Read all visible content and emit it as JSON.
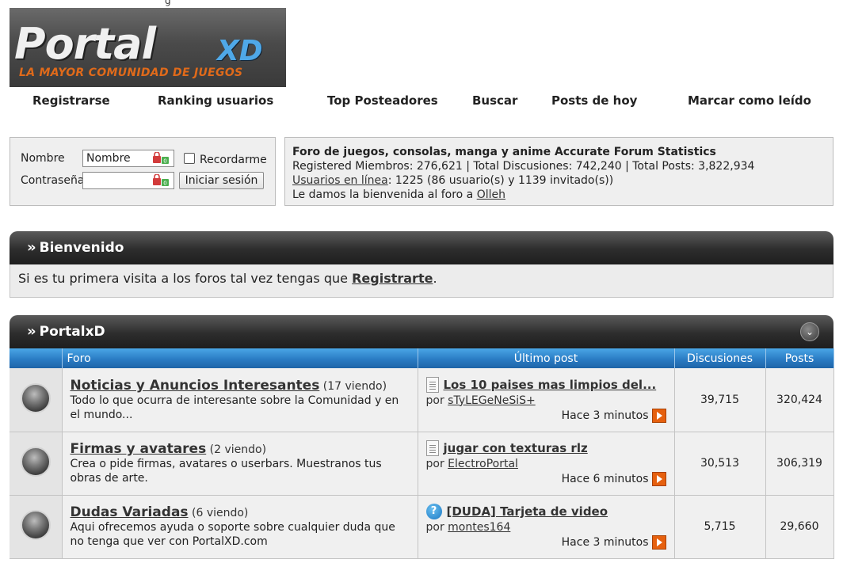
{
  "header": {
    "logo_main": "Portal",
    "logo_xd": "XD",
    "logo_tagline": "LA MAYOR COMUNIDAD DE JUEGOS",
    "clipped_top_text": "g"
  },
  "nav": {
    "items": [
      {
        "label": "Registrarse"
      },
      {
        "label": "Ranking usuarios"
      },
      {
        "label": "Top Posteadores"
      },
      {
        "label": "Buscar"
      },
      {
        "label": "Posts de hoy"
      },
      {
        "label": "Marcar como leído"
      }
    ]
  },
  "login": {
    "username_label": "Nombre",
    "username_value": "Nombre",
    "password_label": "Contraseña",
    "password_value": "",
    "remember_label": "Recordarme",
    "remember_checked": false,
    "submit_label": "Iniciar sesión"
  },
  "stats": {
    "title": "Foro de juegos, consolas, manga y anime Accurate Forum Statistics",
    "line2": "Registered Miembros: 276,621 | Total Discusiones: 742,240 | Total Posts: 3,822,934",
    "online_link": "Usuarios en línea",
    "online_rest": ": 1225 (86 usuario(s) y 1139 invitado(s))",
    "welcome_prefix": "Le damos la bienvenida al foro a ",
    "welcome_user": "Olleh"
  },
  "welcome_section": {
    "title": "Bienvenido",
    "text_prefix": "Si es tu primera visita a los foros tal vez tengas que ",
    "link": "Registrarte",
    "text_suffix": "."
  },
  "forum_section": {
    "title": "PortalxD",
    "columns": {
      "forum": "Foro",
      "last_post": "Último post",
      "threads": "Discusiones",
      "posts": "Posts"
    },
    "rows": [
      {
        "title": "Noticias y Anuncios Interesantes",
        "viewing": "(17 viendo)",
        "description": "Todo lo que ocurra de interesante sobre la Comunidad y en el mundo...",
        "last_post_title": "Los 10 paises mas limpios del...",
        "last_post_icon": "document-icon",
        "by_prefix": "por ",
        "by_user": "sTyLEGeNeSiS+",
        "time": "Hace 3 minutos",
        "threads": "39,715",
        "posts": "320,424"
      },
      {
        "title": "Firmas y avatares",
        "viewing": "(2 viendo)",
        "description": "Crea o pide firmas, avatares o userbars. Muestranos tus obras de arte.",
        "last_post_title": "jugar con texturas rlz",
        "last_post_icon": "document-icon",
        "by_prefix": "por ",
        "by_user": "ElectroPortal",
        "time": "Hace 6 minutos",
        "threads": "30,513",
        "posts": "306,319"
      },
      {
        "title": "Dudas Variadas",
        "viewing": "(6 viendo)",
        "description": "Aqui ofrecemos ayuda o soporte sobre cualquier duda que no tenga que ver con PortalXD.com",
        "last_post_title": "[DUDA] Tarjeta de video",
        "last_post_icon": "question-icon",
        "by_prefix": "por ",
        "by_user": "montes164",
        "time": "Hace 3 minutos",
        "threads": "5,715",
        "posts": "29,660"
      }
    ]
  },
  "colors": {
    "header_dark": "#2d2d2d",
    "table_head_blue": "#2a7cc4",
    "goto_orange": "#e6600e",
    "logo_blue": "#4fa8e8",
    "logo_orange": "#e06a1a"
  }
}
